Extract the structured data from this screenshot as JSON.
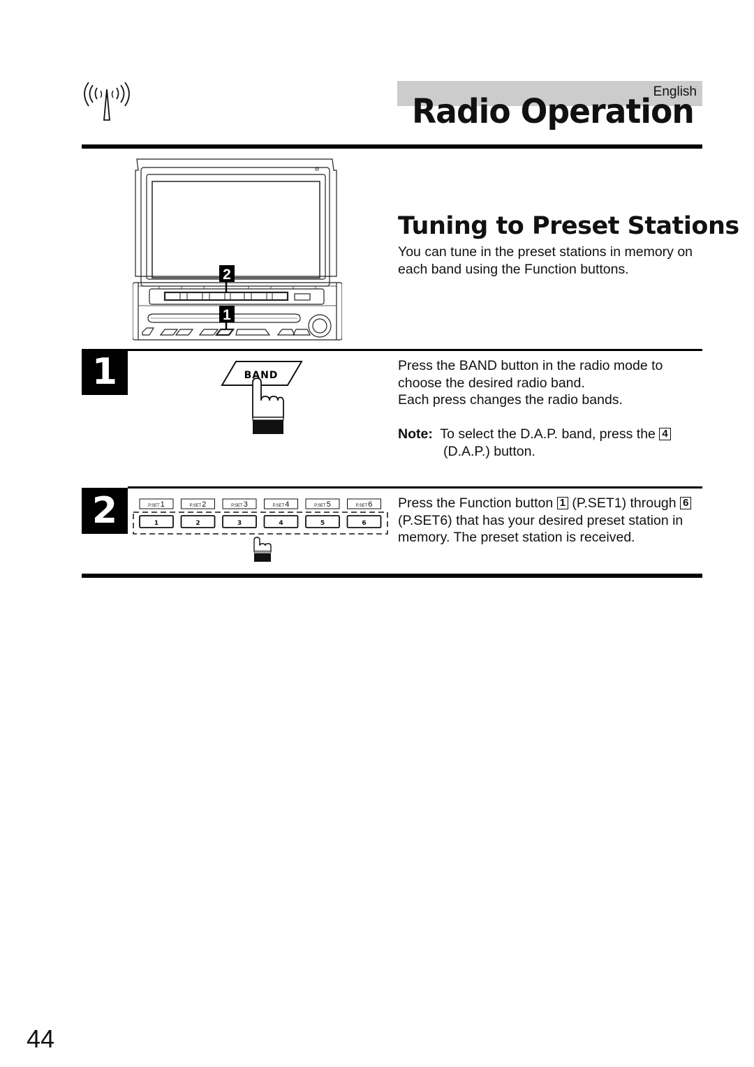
{
  "header": {
    "language": "English",
    "title": "Radio Operation",
    "icon": "antenna-icon"
  },
  "device_illustration": {
    "callouts": [
      "2",
      "1"
    ]
  },
  "section": {
    "title": "Tuning to Preset Stations",
    "intro": "You can tune in the preset stations in memory on each band using the Function buttons."
  },
  "steps": [
    {
      "number": "1",
      "illustration": {
        "button_label": "BAND",
        "icon": "pressing-hand-icon"
      },
      "text_line1": "Press the BAND button in the radio mode to choose the desired radio band.",
      "text_line2": "Each press changes the radio bands.",
      "note": {
        "label": "Note:",
        "text_before": "To select the D.A.P. band, press the",
        "key": "4",
        "text_after": "(D.A.P.) button."
      }
    },
    {
      "number": "2",
      "illustration": {
        "preset_labels": [
          {
            "prefix": "P.SET",
            "num": "1"
          },
          {
            "prefix": "P.SET",
            "num": "2"
          },
          {
            "prefix": "P.SET",
            "num": "3"
          },
          {
            "prefix": "P.SET",
            "num": "4"
          },
          {
            "prefix": "P.SET",
            "num": "5"
          },
          {
            "prefix": "P.SET",
            "num": "6"
          }
        ],
        "buttons": [
          "1",
          "2",
          "3",
          "4",
          "5",
          "6"
        ]
      },
      "text": {
        "part1": "Press the Function button",
        "key1": "1",
        "part2": "(P.SET1) through",
        "key2": "6",
        "part3": "(P.SET6) that has your desired preset station in memory. The preset station is received."
      }
    }
  ],
  "page_number": "44"
}
